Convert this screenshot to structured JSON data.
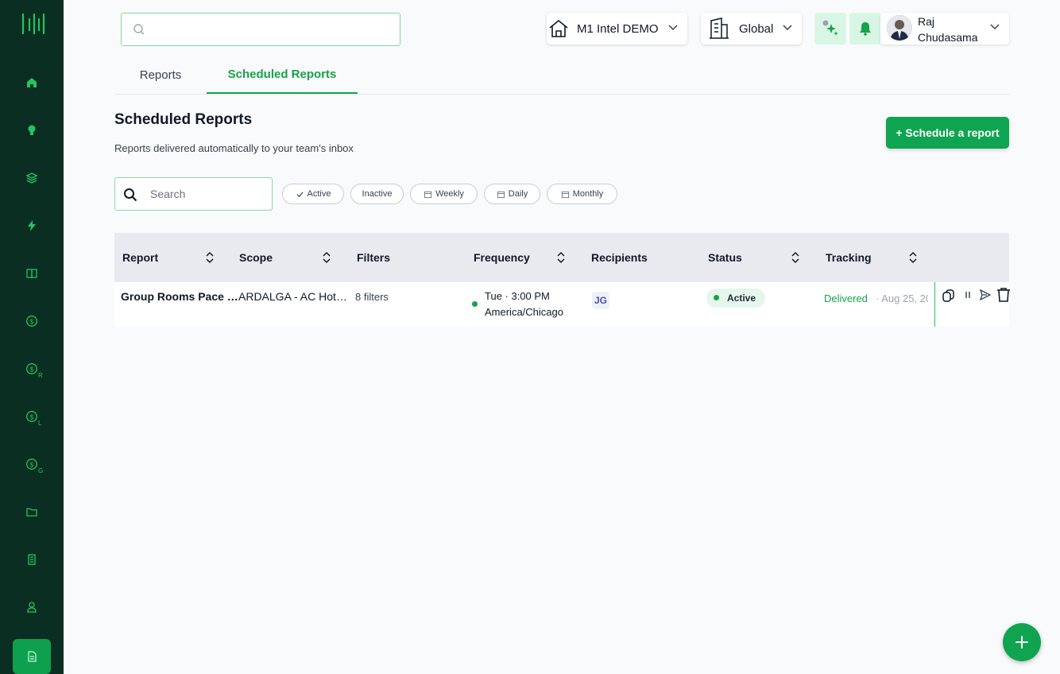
{
  "brand": {
    "accent": "#16a34a",
    "sidebar_bg": "#0b2e22"
  },
  "sidebar": {
    "items": [
      {
        "icon": "home-icon"
      },
      {
        "icon": "lightbulb-icon"
      },
      {
        "icon": "layers-icon"
      },
      {
        "icon": "lightning-icon"
      },
      {
        "icon": "book-icon"
      },
      {
        "icon": "dollar-icon"
      },
      {
        "icon": "dollar-r-icon",
        "sub": "R"
      },
      {
        "icon": "dollar-l-icon",
        "sub": "L"
      },
      {
        "icon": "dollar-g-icon",
        "sub": "G"
      },
      {
        "icon": "folder-icon"
      },
      {
        "icon": "building-icon"
      },
      {
        "icon": "user-icon"
      },
      {
        "icon": "document-icon",
        "active": true
      }
    ]
  },
  "header": {
    "search_placeholder": "",
    "property": "M1 Intel DEMO",
    "scope": "Global",
    "user_name": "Raj Chudasama"
  },
  "tabs": [
    {
      "label": "Reports",
      "active": false
    },
    {
      "label": "Scheduled Reports",
      "active": true
    }
  ],
  "page": {
    "title": "Scheduled Reports",
    "subtitle": "Reports delivered automatically to your team's inbox",
    "schedule_button": "+ Schedule a report"
  },
  "filters": {
    "search_placeholder": "Search",
    "chips": [
      "Active",
      "Inactive",
      "Weekly",
      "Daily",
      "Monthly"
    ]
  },
  "table": {
    "columns": [
      "Report",
      "Scope",
      "Filters",
      "Frequency",
      "Recipients",
      "Status",
      "Tracking"
    ],
    "rows": [
      {
        "report": "Group Rooms Pace …",
        "scope": "ARDALGA - AC Hot…",
        "filters": "8 filters",
        "frequency_line1": "Tue · 3:00 PM",
        "frequency_line2": "America/Chicago",
        "recipient_initials": "JG",
        "status": "Active",
        "tracking_status": "Delivered",
        "tracking_date": "· Aug 25, 20"
      }
    ]
  }
}
